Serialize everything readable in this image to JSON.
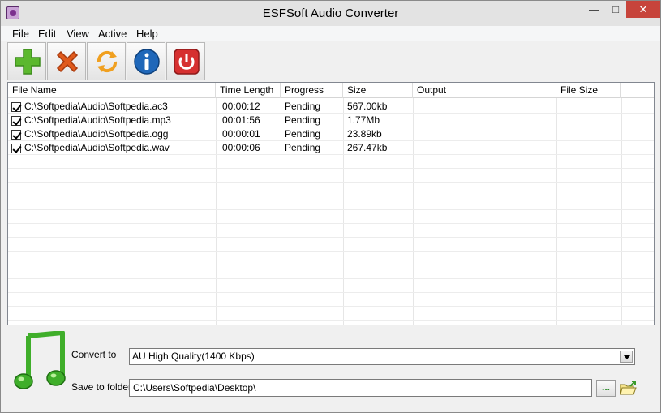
{
  "window": {
    "title": "ESFSoft Audio Converter"
  },
  "menu": [
    "File",
    "Edit",
    "View",
    "Active",
    "Help"
  ],
  "table": {
    "headers": [
      "File Name",
      "Time Length",
      "Progress",
      "Size",
      "Output",
      "File Size"
    ],
    "rows": [
      {
        "checked": true,
        "file": "C:\\Softpedia\\Audio\\Softpedia.ac3",
        "time": "00:00:12",
        "progress": "Pending",
        "size": "567.00kb",
        "output": "",
        "file_size": ""
      },
      {
        "checked": true,
        "file": "C:\\Softpedia\\Audio\\Softpedia.mp3",
        "time": "00:01:56",
        "progress": "Pending",
        "size": "1.77Mb",
        "output": "",
        "file_size": ""
      },
      {
        "checked": true,
        "file": "C:\\Softpedia\\Audio\\Softpedia.ogg",
        "time": "00:00:01",
        "progress": "Pending",
        "size": "23.89kb",
        "output": "",
        "file_size": ""
      },
      {
        "checked": true,
        "file": "C:\\Softpedia\\Audio\\Softpedia.wav",
        "time": "00:00:06",
        "progress": "Pending",
        "size": "267.47kb",
        "output": "",
        "file_size": ""
      }
    ]
  },
  "bottom": {
    "convert_label": "Convert to",
    "convert_value": "AU High Quality(1400 Kbps)",
    "save_label": "Save to folder",
    "save_value": "C:\\Users\\Softpedia\\Desktop\\",
    "browse_label": "..."
  },
  "toolbar": {
    "icons": [
      "add-icon",
      "remove-icon",
      "convert-icon",
      "info-icon",
      "power-icon"
    ]
  },
  "colors": {
    "close": "#c7443b",
    "add": "#5cb82e",
    "remove": "#e05a1c",
    "info": "#1f67b9",
    "power": "#d63030",
    "note": "#3fae2a"
  }
}
